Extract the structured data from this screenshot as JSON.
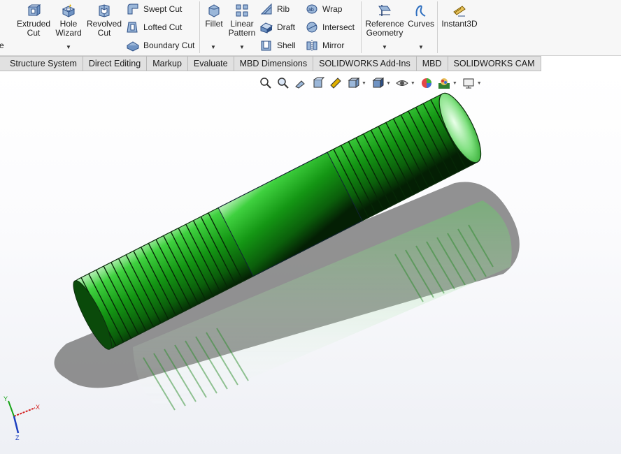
{
  "ribbon": {
    "extruded_cut": "Extruded\nCut",
    "hole_wizard": "Hole\nWizard",
    "revolved_cut": "Revolved\nCut",
    "swept_cut": "Swept Cut",
    "lofted_cut": "Lofted Cut",
    "boundary_cut": "Boundary Cut",
    "fillet": "Fillet",
    "linear_pattern": "Linear\nPattern",
    "rib": "Rib",
    "draft": "Draft",
    "shell": "Shell",
    "wrap": "Wrap",
    "intersect": "Intersect",
    "mirror": "Mirror",
    "reference_geometry": "Reference\nGeometry",
    "curves": "Curves",
    "instant3d": "Instant3D",
    "left_fragment": "e"
  },
  "tabs": [
    "Structure System",
    "Direct Editing",
    "Markup",
    "Evaluate",
    "MBD Dimensions",
    "SOLIDWORKS Add-Ins",
    "MBD",
    "SOLIDWORKS CAM"
  ],
  "triad": {
    "x": "X",
    "y": "Y",
    "z": "Z"
  },
  "colors": {
    "part": "#22b522",
    "part_dark": "#0a5a0a",
    "shadow": "#6e6e6e",
    "axis_x": "#d32020",
    "axis_y": "#17a317",
    "axis_z": "#1c3fbf"
  }
}
